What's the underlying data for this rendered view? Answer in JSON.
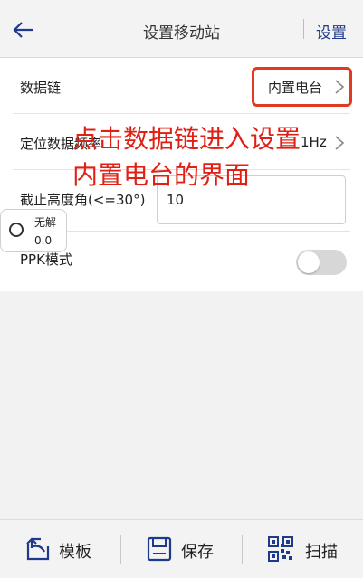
{
  "header": {
    "title": "设置移动站",
    "action_label": "设置"
  },
  "settings": {
    "datalink": {
      "label": "数据链",
      "value": "内置电台"
    },
    "position_rate": {
      "label": "定位数据频率",
      "value": "1Hz"
    },
    "cutoff_angle": {
      "label": "截止高度角(<=30°)",
      "value": "10"
    },
    "ppk_mode": {
      "label": "PPK模式",
      "enabled": false
    }
  },
  "annotation": {
    "line1": "点击数据链进入设置",
    "line2": "内置电台的界面",
    "color": "#e02015"
  },
  "status": {
    "solution": "无解",
    "value": "0.0"
  },
  "toolbar": {
    "template_label": "模板",
    "save_label": "保存",
    "scan_label": "扫描"
  },
  "colors": {
    "accent": "#1f3a8c",
    "highlight": "#e23a20"
  }
}
